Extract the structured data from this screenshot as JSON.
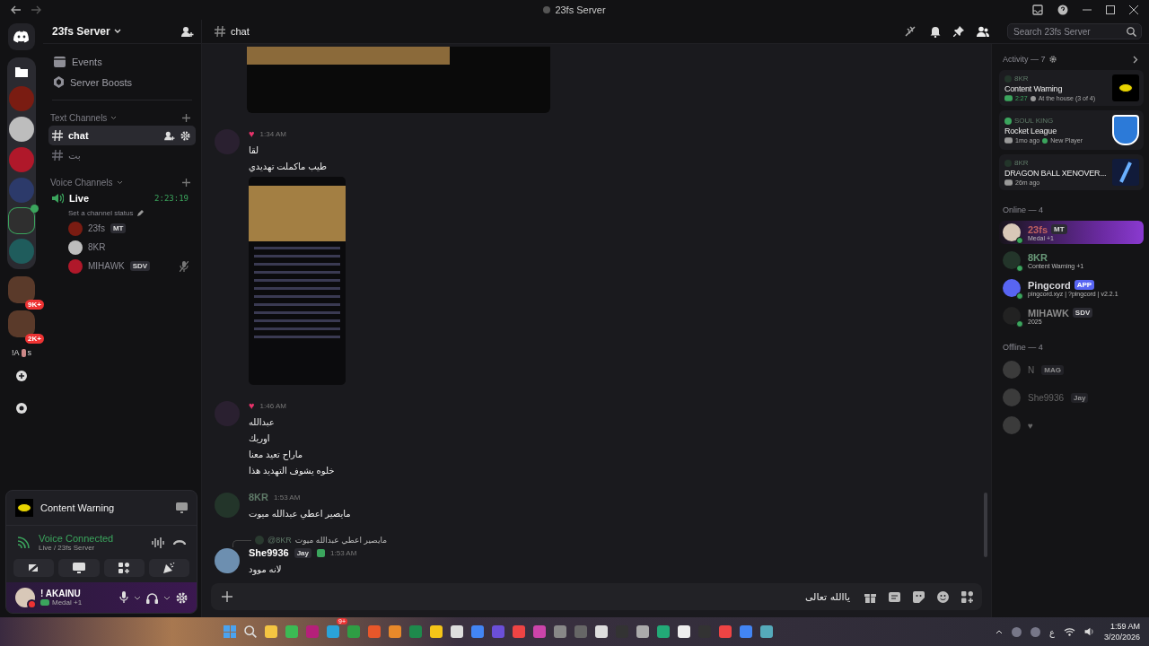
{
  "window": {
    "title": "23fs Server"
  },
  "server_folder": {
    "expanded": true,
    "servers": [
      {
        "selected": false,
        "voice": false
      },
      {
        "selected": false,
        "voice": false
      },
      {
        "selected": false,
        "voice": false
      },
      {
        "selected": false,
        "voice": false
      },
      {
        "selected": true,
        "voice": true
      },
      {
        "selected": false,
        "voice": false
      }
    ]
  },
  "more_servers": [
    {
      "badge": "9K+"
    },
    {
      "badge": "2K+"
    }
  ],
  "server_label": {
    "left": "!A",
    "right": "s"
  },
  "server": {
    "name": "23fs Server"
  },
  "nav_items": [
    "Events",
    "Server Boosts"
  ],
  "text_category": "Text Channels",
  "text_channels": [
    {
      "name": "chat",
      "selected": true
    },
    {
      "name": "بت",
      "selected": false
    }
  ],
  "voice_category": "Voice Channels",
  "voice_channel": {
    "name": "Live",
    "timer": "2:23:19",
    "status": "Set a channel status",
    "members": [
      {
        "name": "23fs",
        "tag": "MT",
        "muted": false
      },
      {
        "name": "8KR",
        "muted": false
      },
      {
        "name": "MIHAWK",
        "tag": "SDV",
        "muted": true
      }
    ]
  },
  "activity_panel": {
    "title": "Content Warning"
  },
  "voice_status": {
    "title": "Voice Connected",
    "location": "Live / 23fs Server"
  },
  "user": {
    "name": "! AKAINU",
    "status": "Medal +1"
  },
  "header": {
    "channel": "chat",
    "search_placeholder": "Search 23fs Server"
  },
  "messages": [
    {
      "kind": "attachment"
    },
    {
      "kind": "message",
      "author": "♥",
      "time": "1:34 AM",
      "lines": [
        "لقا",
        "طيب ماكملت تهديدي"
      ],
      "attachment": true
    },
    {
      "kind": "message",
      "author": "♥",
      "time": "1:46 AM",
      "lines": [
        "عبدالله",
        "اوريك",
        "ماراح تعيد معنا",
        "خلوه يشوف التهديد هذا"
      ]
    },
    {
      "kind": "message",
      "author": "8KR",
      "time": "1:53 AM",
      "lines": [
        "مايصير اعطي عبدالله ميوت"
      ]
    },
    {
      "kind": "reply",
      "reply_to": "@8KR",
      "reply_text": "مايصير اعطي عبدالله ميوت",
      "author": "She9936",
      "tag": "Jay",
      "time": "1:53 AM",
      "lines": [
        "لانه موود"
      ]
    }
  ],
  "composer": {
    "value": "ياالله تعالى"
  },
  "activity": {
    "title": "Activity — 7",
    "cards": [
      {
        "kind": "eye",
        "user": "8KR",
        "game": "Content Warning",
        "time": "2:27",
        "detail": "At the house (3 of 4)"
      },
      {
        "kind": "shield",
        "user": "SOUL KING",
        "game": "Rocket League",
        "time": "1mo ago",
        "detail": "New Player"
      },
      {
        "kind": "x2",
        "user": "8KR",
        "game": "DRAGON BALL XENOVER...",
        "time": "26m ago"
      }
    ]
  },
  "online": {
    "title": "Online — 4",
    "members": [
      {
        "name": "23fs",
        "color": "#c06060",
        "tag": "MT",
        "status": "Medal +1"
      },
      {
        "name": "8KR",
        "color": "#6a9a7a",
        "status": "Content Warning +1"
      },
      {
        "name": "Pingcord",
        "color": "#d8d8dc",
        "tag": "APP",
        "status": "pingcord.xyz | ?pingcord | v2.2.1"
      },
      {
        "name": "MIHAWK",
        "color": "#8a8a8a",
        "tag": "SDV",
        "status": "2025"
      }
    ]
  },
  "offline": {
    "title": "Offline — 4",
    "members": [
      {
        "name": "N",
        "tag": "MAG"
      },
      {
        "name": "She9936",
        "tag": "Jay"
      },
      {
        "name": "♥"
      }
    ]
  },
  "taskbar": {
    "badge": "9+",
    "language": "ع",
    "time": "1:59 AM",
    "date": "3/20/2026"
  }
}
